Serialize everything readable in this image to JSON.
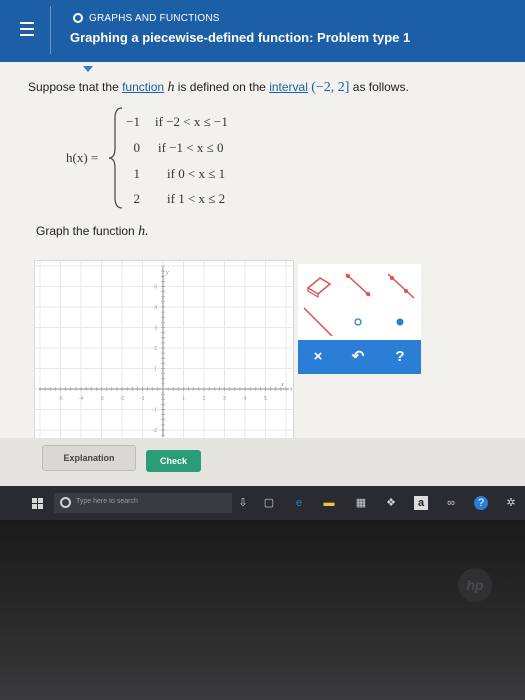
{
  "header": {
    "topic": "GRAPHS AND FUNCTIONS",
    "title": "Graphing a piecewise-defined function: Problem type 1"
  },
  "problem": {
    "intro_1": "Suppose tnat the ",
    "link_function": "function",
    "var_h": "h",
    "intro_2": " is defined on the ",
    "link_interval": "interval",
    "interval": "(−2, 2]",
    "intro_3": " as follows.",
    "function_label": "h(x) =",
    "pieces": [
      {
        "value": "−1",
        "condition": "if −2 < x ≤ −1"
      },
      {
        "value": "0",
        "condition": "if −1 < x ≤ 0"
      },
      {
        "value": "1",
        "condition": "if 0 < x ≤ 1"
      },
      {
        "value": "2",
        "condition": "if 1 < x ≤ 2"
      }
    ],
    "graph_instruction": "Graph the function ",
    "graph_var": "h."
  },
  "graph": {
    "x_axis_label": "x",
    "y_axis_label": "y",
    "x_ticks": [
      "-5",
      "-4",
      "-3",
      "-2",
      "-1",
      "1",
      "2",
      "3",
      "4",
      "5"
    ],
    "y_ticks": [
      "5",
      "4",
      "3",
      "2",
      "1",
      "-1",
      "-2"
    ]
  },
  "tools": {
    "eraser": "eraser-icon",
    "segment_closed_closed": "segment-tool",
    "ray": "ray-tool",
    "open_point": "open-point-tool",
    "closed_point": "closed-point-tool",
    "clear": "×",
    "undo": "↶",
    "help": "?"
  },
  "actions": {
    "explanation": "Explanation",
    "check": "Check"
  },
  "taskbar": {
    "search_placeholder": "Type here to search"
  },
  "colors": {
    "header": "#1d5fa6",
    "accent": "#2b7ed6",
    "check_button": "#2b9c78",
    "tool_red": "#e0514b"
  }
}
